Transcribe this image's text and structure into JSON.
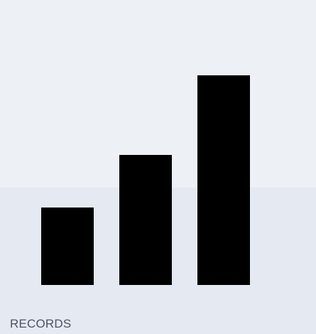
{
  "tile": {
    "caption": "RECORDS",
    "icon": "bar-chart-icon",
    "bar_levels": [
      0.37,
      0.62,
      1.0
    ]
  },
  "colors": {
    "background_top": "#edf0f5",
    "background_bottom": "#e5e9f2",
    "bars": "#000000",
    "caption": "#4b5363"
  }
}
